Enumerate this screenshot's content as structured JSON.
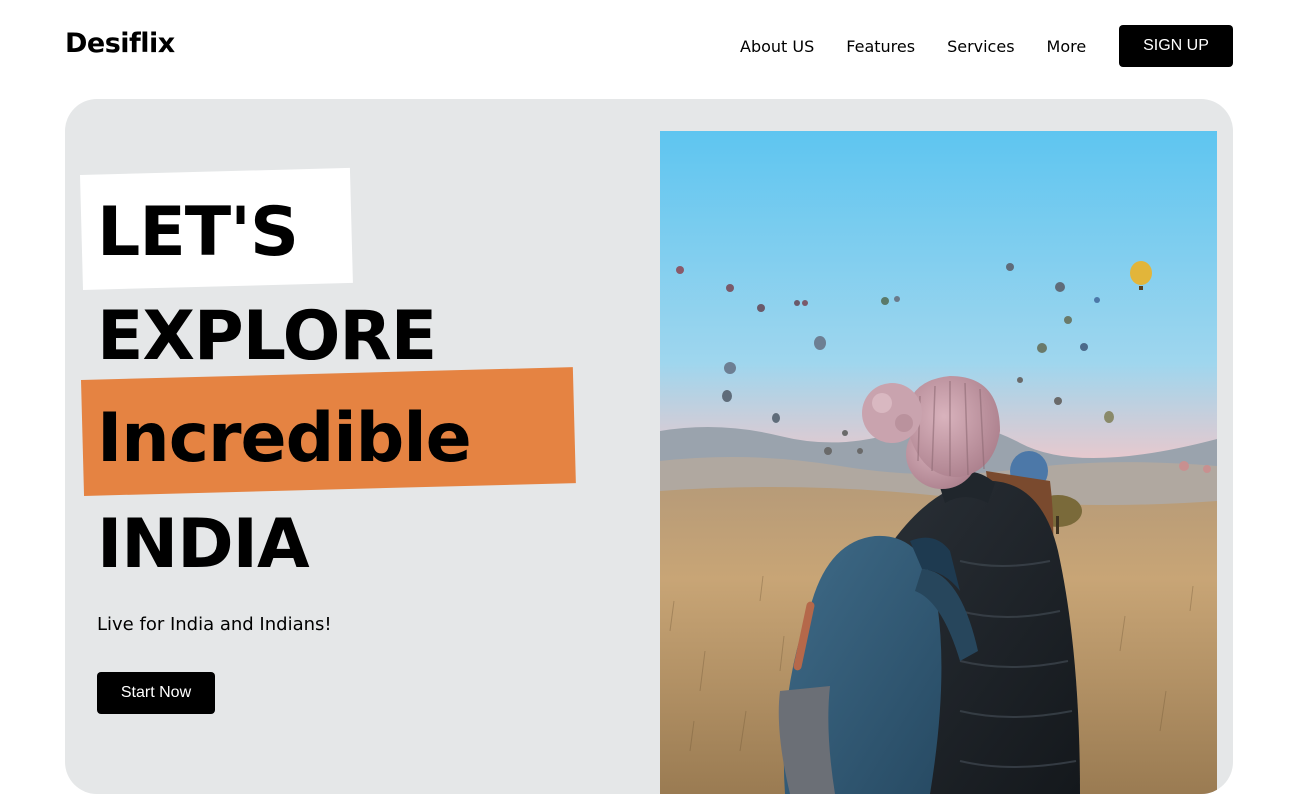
{
  "header": {
    "brand": "Desiflix",
    "nav": [
      {
        "label": "About US"
      },
      {
        "label": "Features"
      },
      {
        "label": "Services"
      },
      {
        "label": "More"
      }
    ],
    "signup_label": "SIGN UP"
  },
  "hero": {
    "headline": [
      "LET'S",
      "EXPLORE",
      "Incredible",
      "INDIA"
    ],
    "tagline": "Live for India and Indians!",
    "cta_label": "Start Now",
    "photo_icon": "hot-air-balloon-traveler-photo"
  },
  "colors": {
    "accent_orange": "#e58342",
    "card_background": "#e5e7e8",
    "button_background": "#000000"
  }
}
